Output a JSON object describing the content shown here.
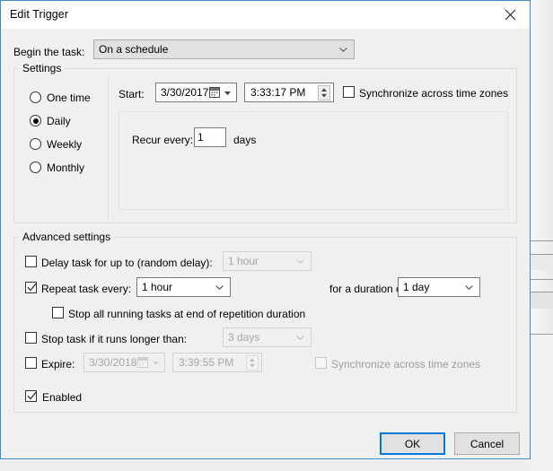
{
  "window": {
    "title": "Edit Trigger",
    "close_icon": "close-icon"
  },
  "begin": {
    "label": "Begin the task:",
    "value": "On a schedule"
  },
  "settings": {
    "title": "Settings",
    "schedule_options": [
      {
        "label": "One time",
        "selected": false
      },
      {
        "label": "Daily",
        "selected": true
      },
      {
        "label": "Weekly",
        "selected": false
      },
      {
        "label": "Monthly",
        "selected": false
      }
    ],
    "start_label": "Start:",
    "start_date": "3/30/2017",
    "start_time": "3:33:17 PM",
    "sync_timezones_label": "Synchronize across time zones",
    "sync_timezones_checked": false,
    "recur_label": "Recur every:",
    "recur_value": "1",
    "recur_units": "days"
  },
  "advanced": {
    "title": "Advanced settings",
    "delay_label": "Delay task for up to (random delay):",
    "delay_checked": false,
    "delay_value": "1 hour",
    "repeat_label": "Repeat task every:",
    "repeat_checked": true,
    "repeat_value": "1 hour",
    "duration_label": "for a duration of:",
    "duration_value": "1 day",
    "stop_at_end_label": "Stop all running tasks at end of repetition duration",
    "stop_at_end_checked": false,
    "stop_longer_label": "Stop task if it runs longer than:",
    "stop_longer_checked": false,
    "stop_longer_value": "3 days",
    "expire_label": "Expire:",
    "expire_checked": false,
    "expire_date": "3/30/2018",
    "expire_time": "3:39:55 PM",
    "expire_sync_label": "Synchronize across time zones",
    "expire_sync_checked": false,
    "enabled_label": "Enabled",
    "enabled_checked": true
  },
  "footer": {
    "ok_label": "OK",
    "cancel_label": "Cancel"
  },
  "colors": {
    "accent": "#0078d7",
    "dialog_border": "#3a8ccc",
    "face": "#f0f0f0",
    "disabled_text": "#a6a6a6"
  }
}
